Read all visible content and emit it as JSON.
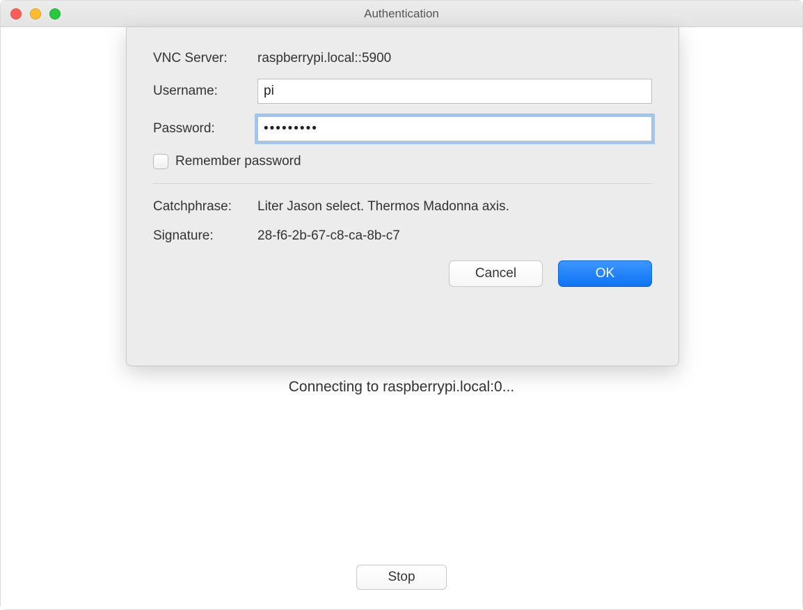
{
  "window": {
    "title": "Authentication"
  },
  "sheet": {
    "server_label": "VNC Server:",
    "server_value": "raspberrypi.local::5900",
    "username_label": "Username:",
    "username_value": "pi",
    "password_label": "Password:",
    "password_value": "•••••••••",
    "remember_label": "Remember password",
    "remember_checked": false,
    "catchphrase_label": "Catchphrase:",
    "catchphrase_value": "Liter Jason select. Thermos Madonna axis.",
    "signature_label": "Signature:",
    "signature_value": "28-f6-2b-67-c8-ca-8b-c7",
    "cancel_label": "Cancel",
    "ok_label": "OK"
  },
  "status": {
    "connecting_text": "Connecting to raspberrypi.local:0..."
  },
  "footer": {
    "stop_label": "Stop"
  }
}
